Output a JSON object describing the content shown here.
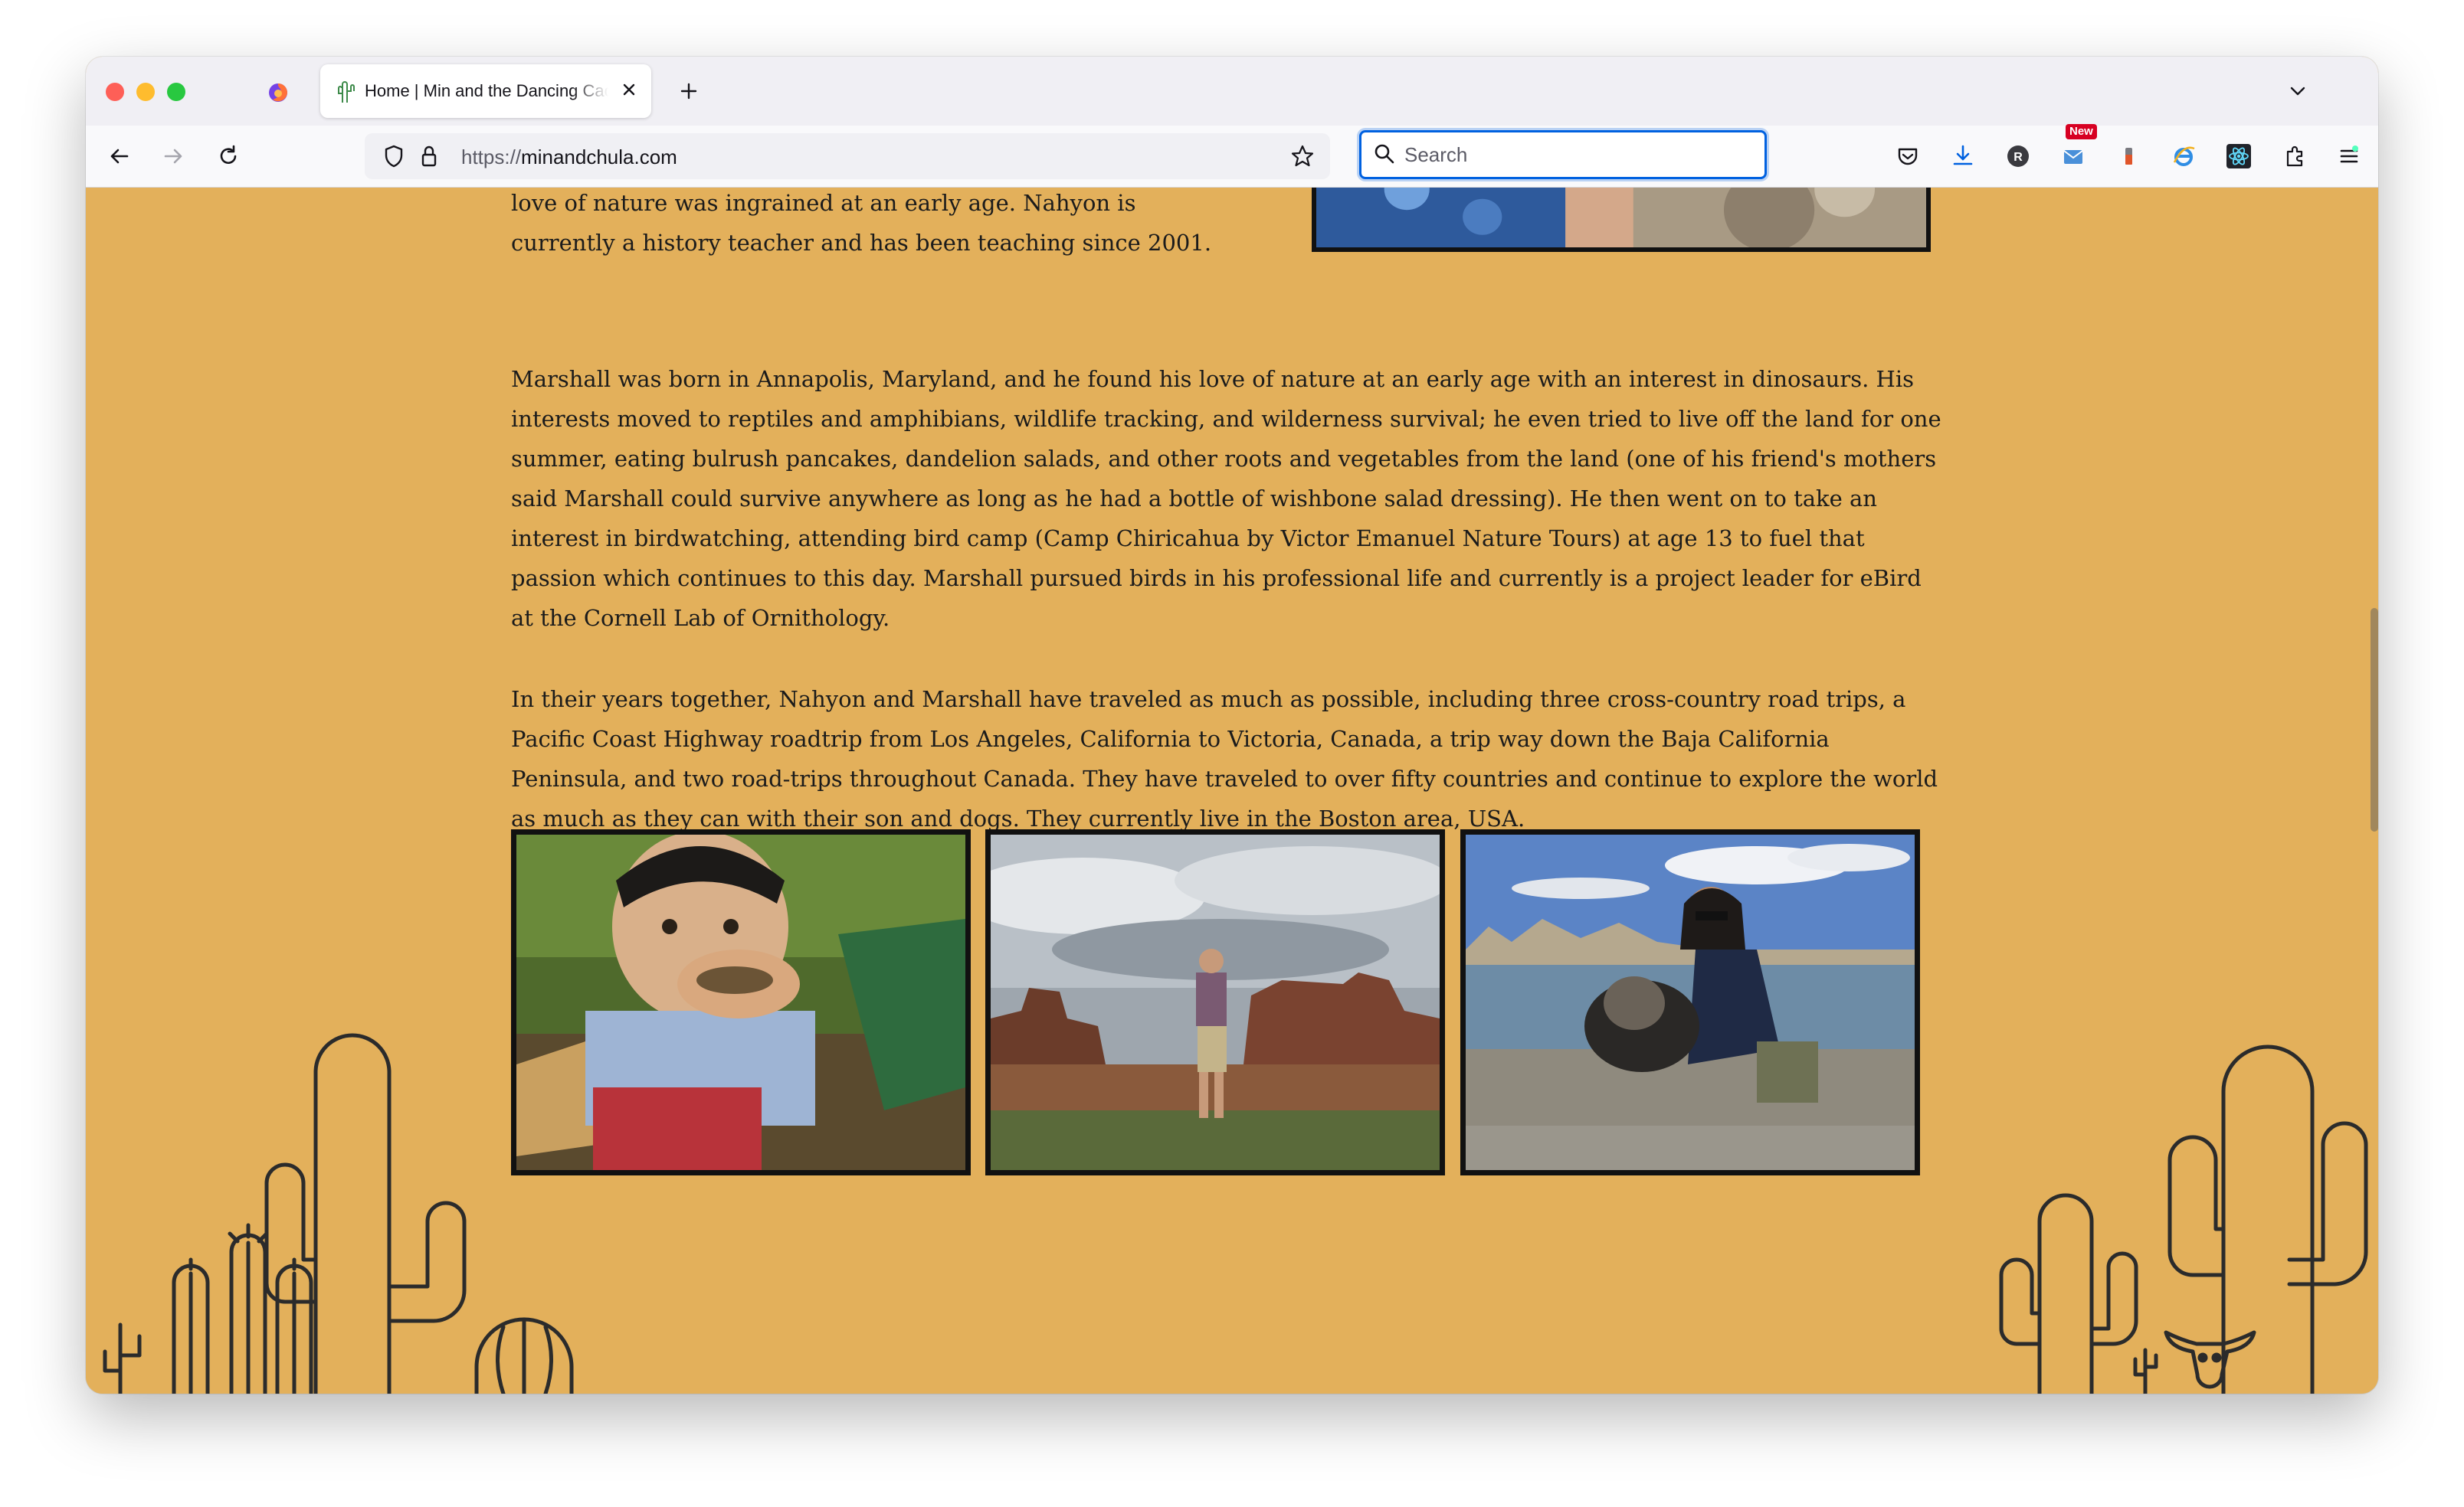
{
  "browser": {
    "tab": {
      "title": "Home | Min and the Dancing Cactus"
    },
    "address": {
      "protocol": "https://",
      "host": "minandchula.com"
    },
    "search": {
      "placeholder": "Search"
    },
    "toolbar": {
      "new_badge": "New"
    }
  },
  "page": {
    "paragraphs": {
      "intro": "love of nature was ingrained at an early age. Nahyon is currently a history teacher and has been teaching since 2001.",
      "marshall": "Marshall was born in Annapolis, Maryland, and he found his love of nature at an early age with an interest in dinosaurs. His interests moved to reptiles and amphibians, wildlife tracking, and wilderness survival; he even tried to live off the land for one summer, eating bulrush pancakes, dandelion salads, and other roots and vegetables from the land (one of his friend's mothers said Marshall could survive anywhere as long as he had a bottle of wishbone salad dressing). He then went on to take an interest in birdwatching, attending bird camp (Camp Chiricahua by Victor Emanuel Nature Tours) at age 13 to fuel that passion which continues to this day. Marshall pursued birds in his professional life and currently is a project leader for eBird at the Cornell Lab of Ornithology.",
      "together": "In their years together, Nahyon and Marshall have traveled as much as possible, including three cross-country road trips, a Pacific Coast Highway roadtrip from Los Angeles, California to Victoria, Canada, a trip way down the Baja California Peninsula, and two road-trips throughout Canada. They have traveled to over fifty countries and continue to explore the world as much as they can with their son and dogs. They currently live in the Boston area, USA."
    },
    "photos": [
      "child-holding-lizard-photo",
      "hiker-at-canyon-photo",
      "woman-with-dog-at-lake-photo"
    ]
  },
  "colors": {
    "page_background": "#e3b05b",
    "text": "#1b1b1b",
    "line_art": "#2b2b2b",
    "focus_ring": "#0061e0"
  }
}
